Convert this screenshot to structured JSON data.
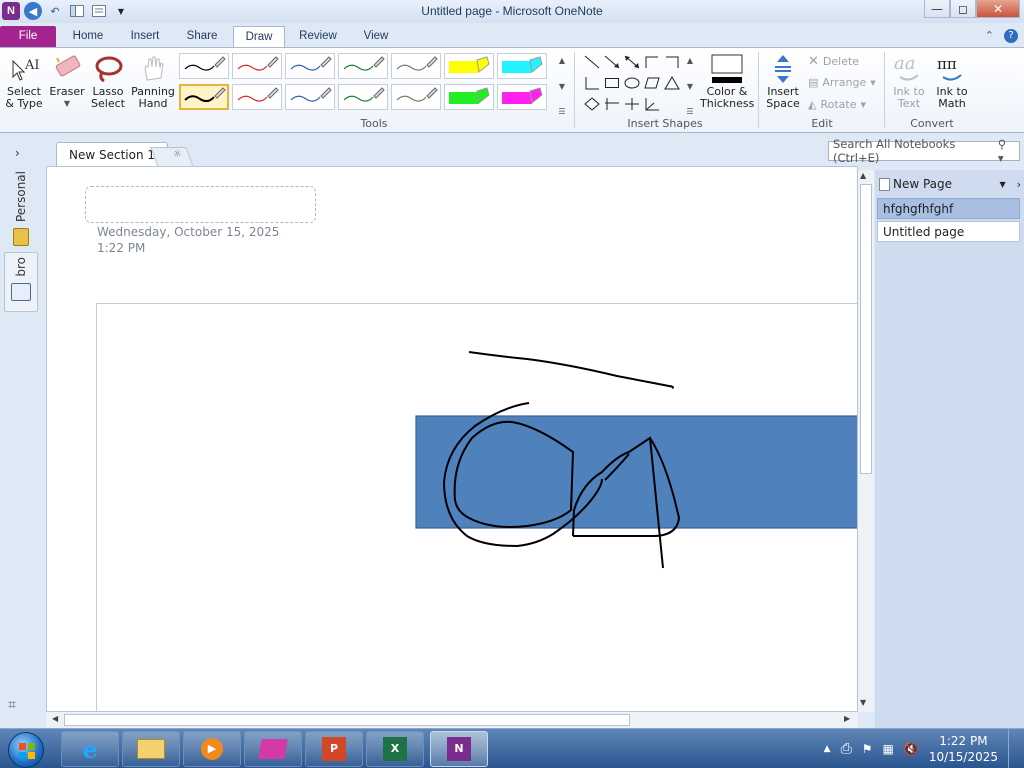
{
  "window": {
    "title": "Untitled page - Microsoft OneNote",
    "buttons": {
      "minimize": "—",
      "maximize": "◻",
      "close": "✕"
    }
  },
  "ribbon_tabs": [
    {
      "label": "File"
    },
    {
      "label": "Home"
    },
    {
      "label": "Insert"
    },
    {
      "label": "Share"
    },
    {
      "label": "Draw"
    },
    {
      "label": "Review"
    },
    {
      "label": "View"
    }
  ],
  "tools": {
    "select_type": "Select & Type",
    "eraser": "Eraser",
    "lasso_select": "Lasso Select",
    "panning_hand": "Panning Hand",
    "group_label": "Tools",
    "pens": [
      {
        "color": "#000000",
        "kind": "pen"
      },
      {
        "color": "#d32b2b",
        "kind": "pen"
      },
      {
        "color": "#2f5fb8",
        "kind": "pen"
      },
      {
        "color": "#1e7a3a",
        "kind": "pen"
      },
      {
        "color": "#777777",
        "kind": "pen"
      },
      {
        "color": "#ffff00",
        "kind": "highlighter"
      },
      {
        "color": "#22f4ff",
        "kind": "highlighter"
      },
      {
        "color": "#000000",
        "kind": "pen"
      },
      {
        "color": "#d32b2b",
        "kind": "pen"
      },
      {
        "color": "#2f5fb8",
        "kind": "pen"
      },
      {
        "color": "#1e7a3a",
        "kind": "pen"
      },
      {
        "color": "#777777",
        "kind": "pen"
      },
      {
        "color": "#22ee22",
        "kind": "highlighter"
      },
      {
        "color": "#ff22ee",
        "kind": "highlighter"
      }
    ]
  },
  "insert_shapes": {
    "group_label": "Insert Shapes",
    "color_thickness": "Color & Thickness"
  },
  "edit": {
    "insert_space": "Insert Space",
    "delete": "Delete",
    "arrange": "Arrange",
    "rotate": "Rotate",
    "group_label": "Edit"
  },
  "convert": {
    "ink_to_text": "Ink to Text",
    "ink_to_math": "Ink to Math",
    "group_label": "Convert"
  },
  "notebooks": [
    {
      "label": "Personal"
    },
    {
      "label": "bro"
    }
  ],
  "section_tab": "New Section 1",
  "search": {
    "placeholder": "Search All Notebooks (Ctrl+E)"
  },
  "page": {
    "date": "Wednesday, October 15, 2025",
    "time": "1:22 PM",
    "shape_fill": "#4f81bd"
  },
  "pagelist": {
    "new_page": "New Page",
    "items": [
      {
        "label": "hfghgfhfghf"
      },
      {
        "label": "Untitled page"
      }
    ]
  },
  "taskbar": {
    "time": "1:22 PM",
    "date": "10/15/2025"
  }
}
